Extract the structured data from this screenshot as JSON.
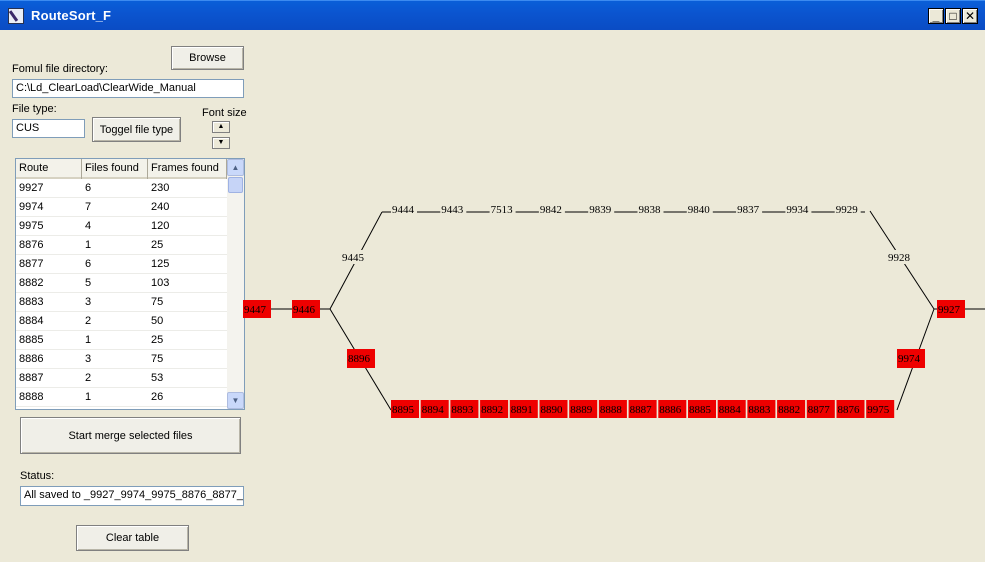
{
  "window": {
    "title": "RouteSort_F",
    "controls": {
      "minimize": "_",
      "maximize": "□",
      "close": "✕"
    }
  },
  "left_panel": {
    "browse_label": "Browse",
    "dir_label": "Fomul file directory:",
    "dir_value": "C:\\Ld_ClearLoad\\ClearWide_Manual",
    "filetype_label": "File type:",
    "filetype_value": "CUS",
    "toggle_label": "Toggel file type",
    "fontsize_label": "Font size",
    "spin_up": "▲",
    "spin_down": "▼",
    "table": {
      "headers": [
        "Route",
        "Files found",
        "Frames found"
      ],
      "rows": [
        [
          "9927",
          "6",
          "230"
        ],
        [
          "9974",
          "7",
          "240"
        ],
        [
          "9975",
          "4",
          "120"
        ],
        [
          "8876",
          "1",
          "25"
        ],
        [
          "8877",
          "6",
          "125"
        ],
        [
          "8882",
          "5",
          "103"
        ],
        [
          "8883",
          "3",
          "75"
        ],
        [
          "8884",
          "2",
          "50"
        ],
        [
          "8885",
          "1",
          "25"
        ],
        [
          "8886",
          "3",
          "75"
        ],
        [
          "8887",
          "2",
          "53"
        ],
        [
          "8888",
          "1",
          "26"
        ]
      ]
    },
    "merge_label": "Start merge selected files",
    "status_label": "Status:",
    "status_value": "All saved to _9927_9974_9975_8876_8877_",
    "clear_label": "Clear table"
  },
  "route_map": {
    "highlight_color": "#ee0000",
    "left_chain": [
      "9447",
      "9446"
    ],
    "left_down": "8896",
    "left_up": "9445",
    "top_row": [
      "9444",
      "9443",
      "7513",
      "9842",
      "9839",
      "9838",
      "9840",
      "9837",
      "9934",
      "9929"
    ],
    "right_up": "9928",
    "right_end": "9927",
    "right_down": "9974",
    "bottom_row": [
      "8895",
      "8894",
      "8893",
      "8892",
      "8891",
      "8890",
      "8889",
      "8888",
      "8887",
      "8886",
      "8885",
      "8884",
      "8883",
      "8882",
      "8877",
      "8876",
      "9975"
    ]
  }
}
